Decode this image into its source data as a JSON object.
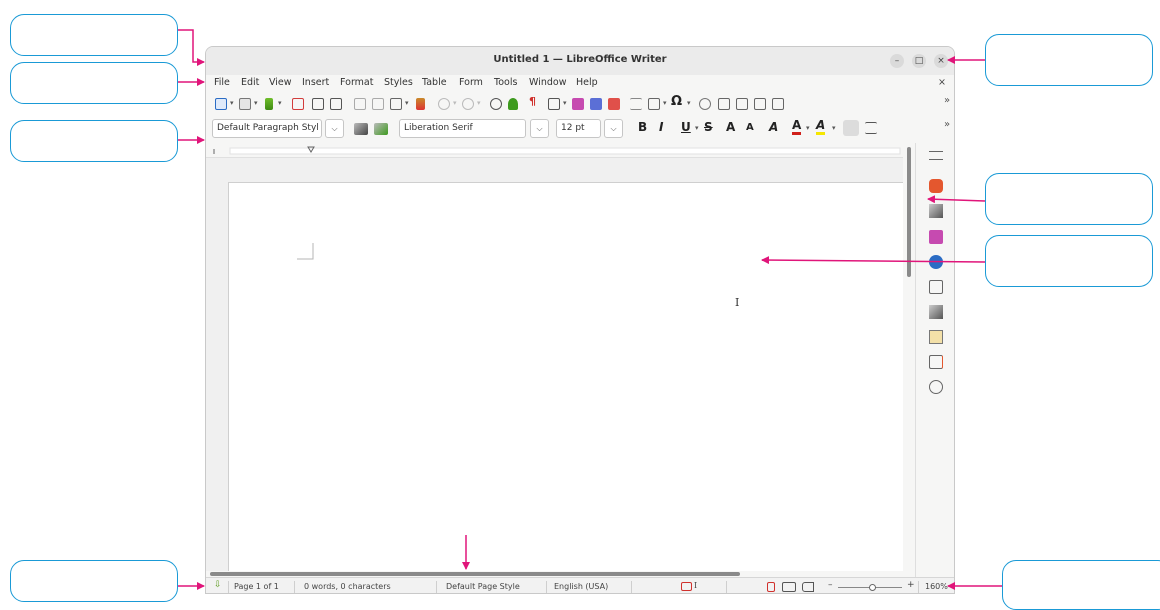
{
  "window": {
    "title": "Untitled 1 — LibreOffice Writer",
    "controls": {
      "minimize": "–",
      "maximize": "□",
      "close": "×"
    }
  },
  "menubar": {
    "items": [
      "File",
      "Edit",
      "View",
      "Insert",
      "Format",
      "Styles",
      "Table",
      "Form",
      "Tools",
      "Window",
      "Help"
    ],
    "close_doc": "×"
  },
  "formatting": {
    "paragraph_style": "Default Paragraph Styl",
    "font_name": "Liberation Serif",
    "font_size": "12 pt",
    "dropdown_glyph": "⌵",
    "bold": "B",
    "italic": "I",
    "underline": "U",
    "strike": "S",
    "superscript": "A",
    "subscript": "A",
    "font_effect": "A",
    "font_color": "A",
    "highlight": "A"
  },
  "toolbar": {
    "omega": "Ω",
    "pilcrow": "¶",
    "more": "»"
  },
  "document": {
    "cursor": "I"
  },
  "statusbar": {
    "page": "Page 1 of 1",
    "words": "0 words, 0 characters",
    "page_style": "Default Page Style",
    "language": "English (USA)",
    "zoom_minus": "–",
    "zoom_plus": "+",
    "zoom": "160%"
  },
  "colors": {
    "accent_blue": "#1a9ad6",
    "arrow_magenta": "#e0157a",
    "window_bg": "#f6f6f5"
  }
}
